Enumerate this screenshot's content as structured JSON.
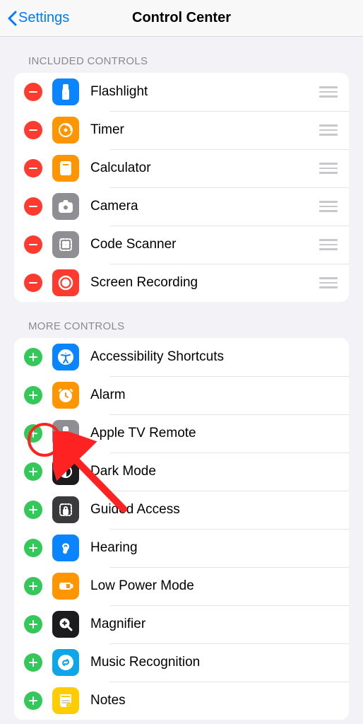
{
  "nav": {
    "back_label": "Settings",
    "title": "Control Center"
  },
  "sections": {
    "included_header": "INCLUDED CONTROLS",
    "more_header": "MORE CONTROLS"
  },
  "included": [
    {
      "label": "Flashlight",
      "icon": "flashlight",
      "bg": "bg-blue"
    },
    {
      "label": "Timer",
      "icon": "timer",
      "bg": "bg-orange"
    },
    {
      "label": "Calculator",
      "icon": "calculator",
      "bg": "bg-orange"
    },
    {
      "label": "Camera",
      "icon": "camera",
      "bg": "bg-gray"
    },
    {
      "label": "Code Scanner",
      "icon": "qrcode",
      "bg": "bg-gray"
    },
    {
      "label": "Screen Recording",
      "icon": "record",
      "bg": "bg-red"
    }
  ],
  "more": [
    {
      "label": "Accessibility Shortcuts",
      "icon": "accessibility",
      "bg": "bg-blue"
    },
    {
      "label": "Alarm",
      "icon": "alarm",
      "bg": "bg-orange"
    },
    {
      "label": "Apple TV Remote",
      "icon": "tvremote",
      "bg": "bg-gray"
    },
    {
      "label": "Dark Mode",
      "icon": "darkmode",
      "bg": "bg-black"
    },
    {
      "label": "Guided Access",
      "icon": "lock",
      "bg": "bg-darkg2"
    },
    {
      "label": "Hearing",
      "icon": "ear",
      "bg": "bg-blue"
    },
    {
      "label": "Low Power Mode",
      "icon": "battery",
      "bg": "bg-orange"
    },
    {
      "label": "Magnifier",
      "icon": "magnifier",
      "bg": "bg-black"
    },
    {
      "label": "Music Recognition",
      "icon": "shazam",
      "bg": "bg-cyan"
    },
    {
      "label": "Notes",
      "icon": "notes",
      "bg": "bg-yellow"
    }
  ],
  "annotation": {
    "highlighted_item": "Apple TV Remote",
    "highlight_action": "add"
  }
}
